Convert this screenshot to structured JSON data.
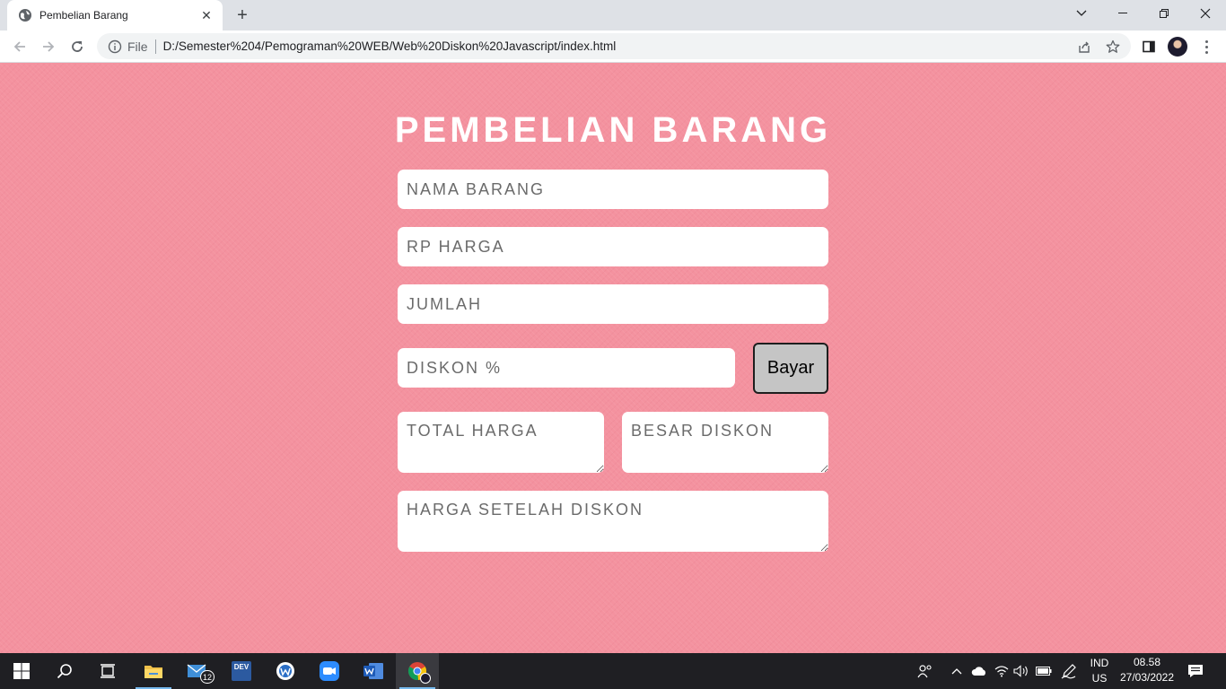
{
  "browser": {
    "tab_title": "Pembelian Barang",
    "tab_close": "✕",
    "new_tab": "+",
    "scheme_label": "File",
    "url": "D:/Semester%204/Pemograman%20WEB/Web%20Diskon%20Javascript/index.html"
  },
  "page": {
    "title": "PEMBELIAN BARANG",
    "fields": {
      "nama_barang": "NAMA BARANG",
      "harga": "RP HARGA",
      "jumlah": "JUMLAH",
      "diskon": "DISKON %",
      "total_harga": "TOTAL HARGA",
      "besar_diskon": "BESAR DISKON",
      "harga_setelah_diskon": "HARGA SETELAH DISKON"
    },
    "bayar_label": "Bayar"
  },
  "taskbar": {
    "mail_badge": "12",
    "devcpp_label": "DEV",
    "language_line1": "IND",
    "language_line2": "US",
    "time": "08.58",
    "date": "27/03/2022"
  },
  "colors": {
    "page_background": "#f4929f",
    "button_background": "#c5c5c5",
    "taskbar": "#1f1f23"
  }
}
